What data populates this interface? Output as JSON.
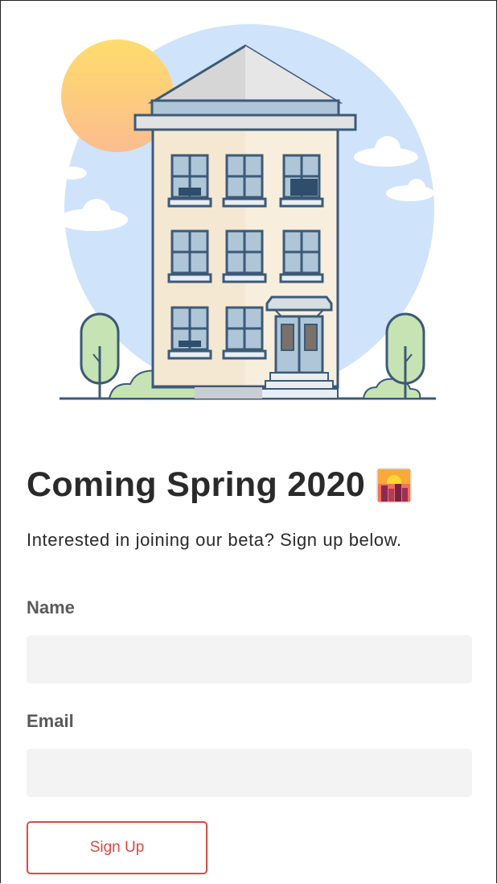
{
  "hero": {
    "illustration": "apartment-building-illustration"
  },
  "heading": {
    "text": "Coming Spring 2020",
    "emoji_icon": "city-sunset-icon"
  },
  "subtitle": "Interested in joining our beta? Sign up below.",
  "form": {
    "name_label": "Name",
    "name_value": "",
    "email_label": "Email",
    "email_value": "",
    "submit_label": "Sign Up"
  },
  "colors": {
    "accent": "#dc4a3f",
    "sky": "#cfe3fb",
    "sun": "#fdd37a",
    "building": "#f4e8d3",
    "outline": "#3c5a78"
  }
}
